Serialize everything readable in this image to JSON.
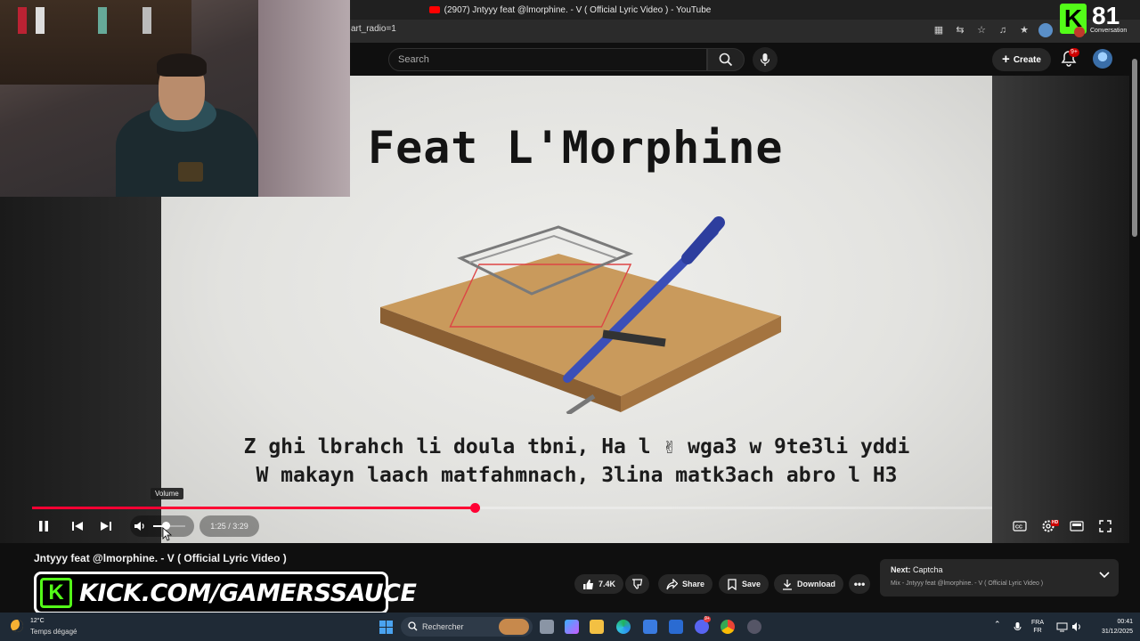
{
  "browser": {
    "tab_title": "(2907) Jntyyy feat @lmorphine. - V ( Official Lyric Video ) - YouTube",
    "url_fragment": "art_radio=1"
  },
  "header": {
    "search_placeholder": "Search",
    "create_label": "Create",
    "notification_count": "9+"
  },
  "stream_overlay": {
    "viewer_count": "81",
    "viewer_label": "Conversation",
    "kick_letter": "K",
    "banner_text": "KICK.COM/GAMERSSAUCE"
  },
  "video": {
    "frame_title": "Feat L'Morphine",
    "lyric_line_1": "Z ghi lbrahch li doula tbni, Ha l ✌ wga3 w 9te3li yddi",
    "lyric_line_2": "W makayn laach matfahmnach, 3lina matk3ach abro l H3"
  },
  "player": {
    "tooltip": "Volume",
    "time": "1:25 / 3:29",
    "progress_fraction": 0.4613,
    "volume_fraction": 0.38,
    "settings_badge": "HD"
  },
  "below": {
    "title": "Jntyyy feat @lmorphine. - V ( Official Lyric Video )",
    "like_count": "7.4K",
    "share_label": "Share",
    "save_label": "Save",
    "download_label": "Download",
    "next_prefix": "Next:",
    "next_title": "Captcha",
    "next_sub": "Mix - Jntyyy feat @lmorphine. - V ( Official Lyric Video )"
  },
  "taskbar": {
    "temperature": "12°C",
    "weather": "Temps dégagé",
    "search_label": "Rechercher",
    "lang_top": "FRA",
    "lang_bottom": "FR",
    "time": "00:41",
    "date": "31/12/2025",
    "discord_badge": "9+"
  },
  "colors": {
    "accent_red": "#ff0033",
    "kick_green": "#53fc18"
  }
}
